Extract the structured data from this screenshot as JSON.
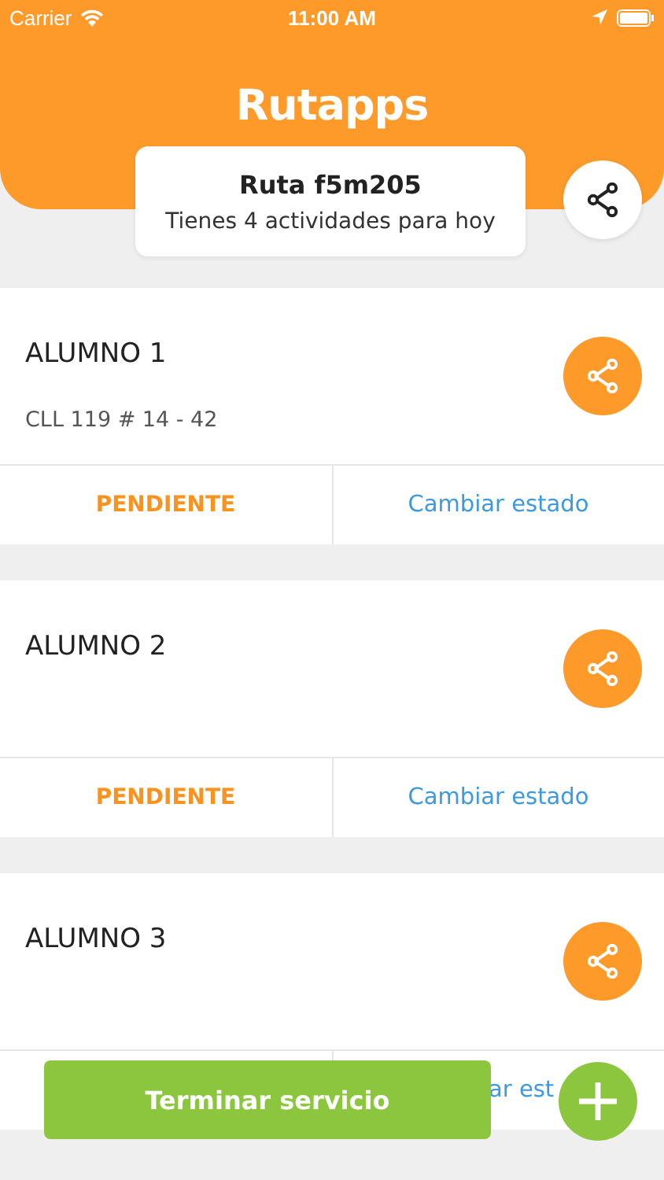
{
  "status_bar": {
    "carrier": "Carrier",
    "time": "11:00 AM"
  },
  "header": {
    "logo": "Rutapps",
    "route_title": "Ruta f5m205",
    "route_subtitle": "Tienes 4 actividades para hoy"
  },
  "students": [
    {
      "name": "ALUMNO 1",
      "address": "CLL 119 # 14 - 42",
      "status": "PENDIENTE",
      "action": "Cambiar estado"
    },
    {
      "name": "ALUMNO 2",
      "status": "PENDIENTE",
      "action": "Cambiar estado"
    },
    {
      "name": "ALUMNO 3",
      "action": "ar est",
      "action_cut": true
    }
  ],
  "finish_button": "Terminar servicio"
}
